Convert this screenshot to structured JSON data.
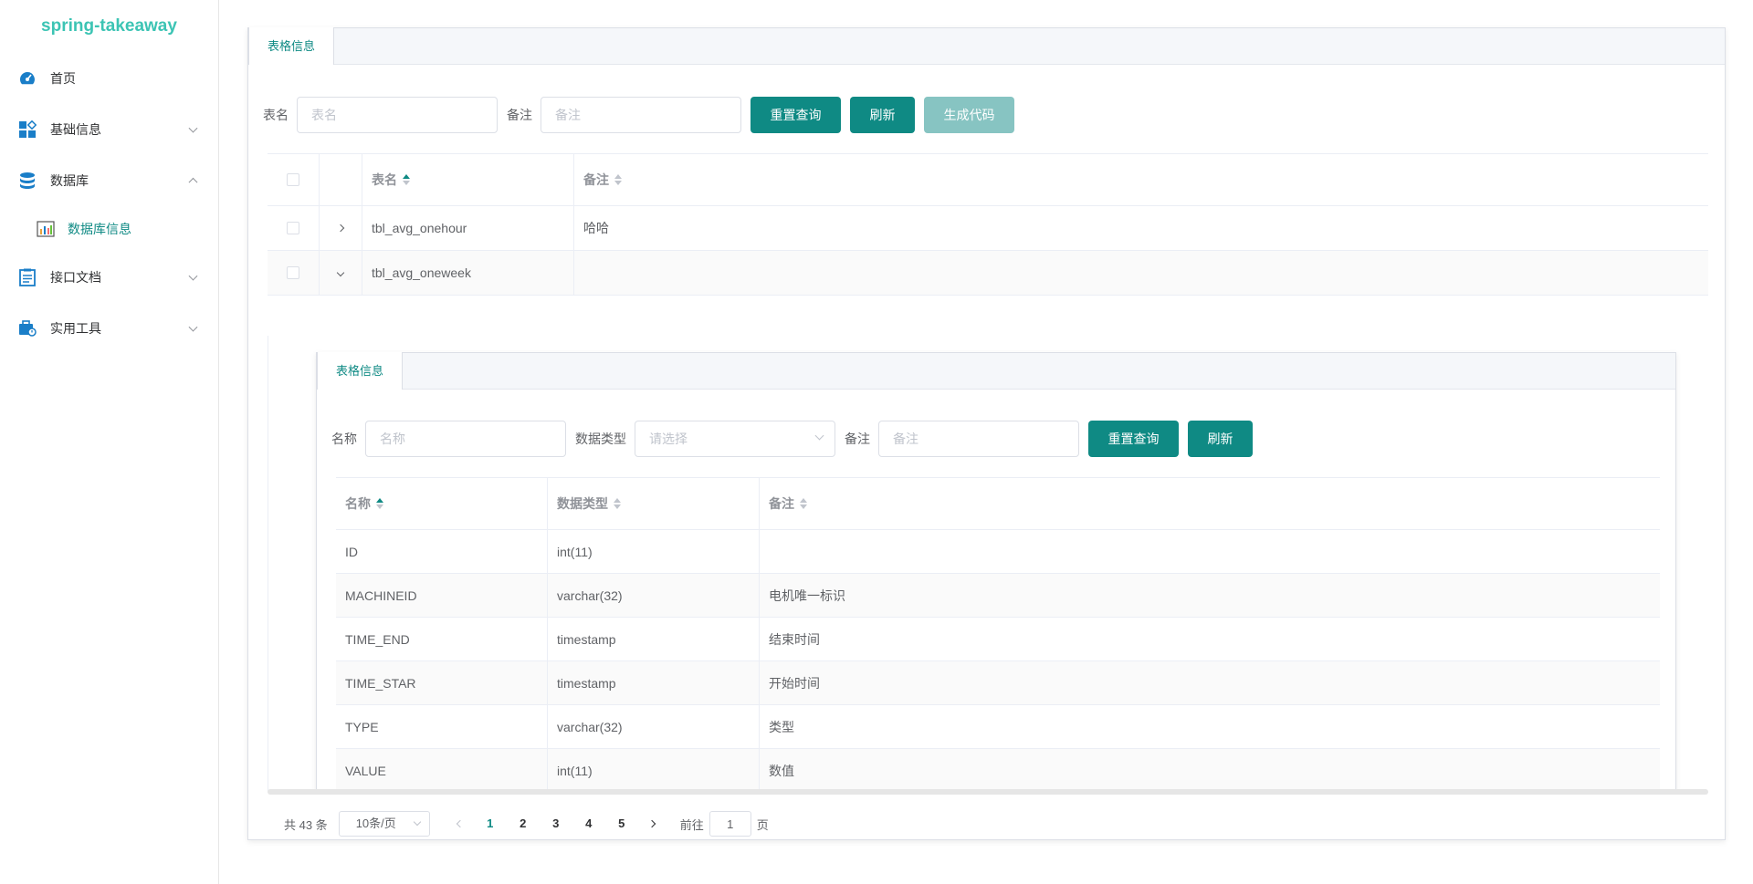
{
  "app": {
    "title": "spring-takeaway"
  },
  "sidebar": {
    "items": [
      {
        "label": "首页",
        "icon": "dashboard-icon"
      },
      {
        "label": "基础信息",
        "icon": "grid-icon"
      },
      {
        "label": "数据库",
        "icon": "database-icon"
      },
      {
        "label": "数据库信息",
        "icon": "chart-icon"
      },
      {
        "label": "接口文档",
        "icon": "document-icon"
      },
      {
        "label": "实用工具",
        "icon": "toolbox-icon"
      }
    ]
  },
  "main": {
    "tab_label": "表格信息",
    "filter": {
      "table_label": "表名",
      "table_placeholder": "表名",
      "remark_label": "备注",
      "remark_placeholder": "备注",
      "reset_btn": "重置查询",
      "refresh_btn": "刷新",
      "generate_btn": "生成代码"
    },
    "table": {
      "headers": {
        "name": "表名",
        "remark": "备注"
      },
      "rows": [
        {
          "name": "tbl_avg_onehour",
          "remark": "哈哈"
        },
        {
          "name": "tbl_avg_oneweek",
          "remark": ""
        }
      ]
    }
  },
  "inner": {
    "tab_label": "表格信息",
    "filter": {
      "name_label": "名称",
      "name_placeholder": "名称",
      "type_label": "数据类型",
      "type_placeholder": "请选择",
      "remark_label": "备注",
      "remark_placeholder": "备注",
      "reset_btn": "重置查询",
      "refresh_btn": "刷新"
    },
    "table": {
      "headers": {
        "name": "名称",
        "type": "数据类型",
        "remark": "备注"
      },
      "rows": [
        {
          "name": "ID",
          "type": "int(11)",
          "remark": ""
        },
        {
          "name": "MACHINEID",
          "type": "varchar(32)",
          "remark": "电机唯一标识"
        },
        {
          "name": "TIME_END",
          "type": "timestamp",
          "remark": "结束时间"
        },
        {
          "name": "TIME_STAR",
          "type": "timestamp",
          "remark": "开始时间"
        },
        {
          "name": "TYPE",
          "type": "varchar(32)",
          "remark": "类型"
        },
        {
          "name": "VALUE",
          "type": "int(11)",
          "remark": "数值"
        }
      ]
    }
  },
  "pagination": {
    "total": "共 43 条",
    "page_size": "10条/页",
    "pages": [
      "1",
      "2",
      "3",
      "4",
      "5"
    ],
    "current": "1",
    "goto_prefix": "前往",
    "goto_value": "1",
    "goto_suffix": "页"
  },
  "colors": {
    "accent": "#0f8a84",
    "logo": "#3cc4b4",
    "disabled": "#87c4c2"
  }
}
